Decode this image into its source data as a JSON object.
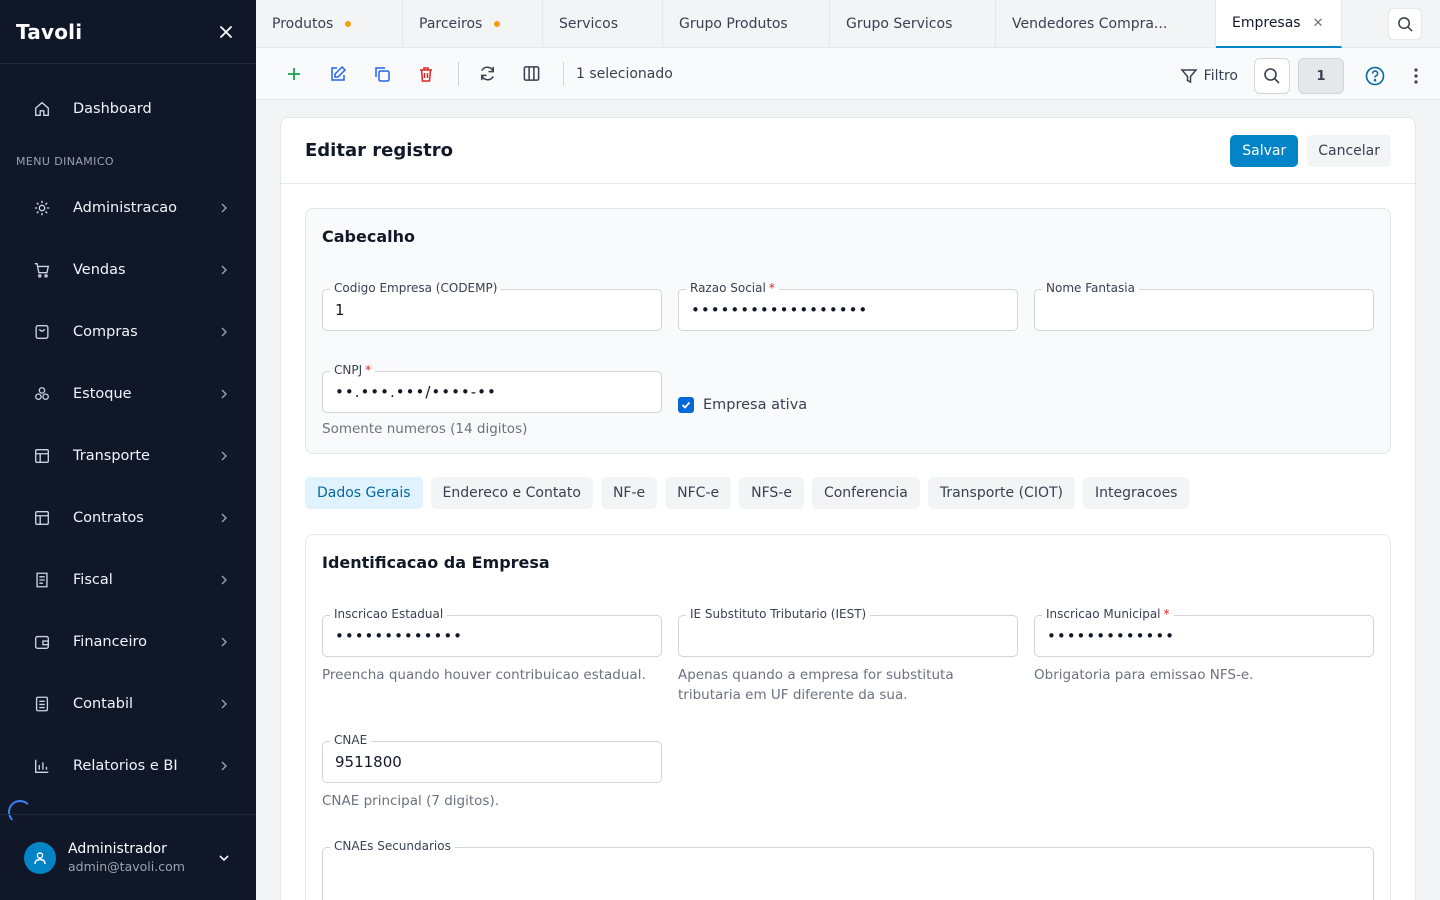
{
  "sidebar": {
    "brand": "Tavoli",
    "dashboard": "Dashboard",
    "section_label": "MENU DINAMICO",
    "items": [
      {
        "label": "Administracao",
        "icon": "gear-icon"
      },
      {
        "label": "Vendas",
        "icon": "cart-icon"
      },
      {
        "label": "Compras",
        "icon": "bag-icon"
      },
      {
        "label": "Estoque",
        "icon": "boxes-icon"
      },
      {
        "label": "Transporte",
        "icon": "layout-icon"
      },
      {
        "label": "Contratos",
        "icon": "layout-icon"
      },
      {
        "label": "Fiscal",
        "icon": "receipt-icon"
      },
      {
        "label": "Financeiro",
        "icon": "wallet-icon"
      },
      {
        "label": "Contabil",
        "icon": "book-icon"
      },
      {
        "label": "Relatorios e BI",
        "icon": "bar-chart-icon"
      }
    ],
    "user": {
      "name": "Administrador",
      "email": "admin@tavoli.com"
    }
  },
  "tabs": [
    {
      "label": "Produtos",
      "dirty": true
    },
    {
      "label": "Parceiros",
      "dirty": true
    },
    {
      "label": "Servicos",
      "dirty": false
    },
    {
      "label": "Grupo Produtos",
      "dirty": false
    },
    {
      "label": "Grupo Servicos",
      "dirty": false
    },
    {
      "label": "Vendedores Compra...",
      "dirty": false
    },
    {
      "label": "Empresas",
      "active": true
    }
  ],
  "toolbar": {
    "selected_text": "1 selecionado",
    "filter_label": "Filtro",
    "count": "1"
  },
  "form": {
    "title": "Editar registro",
    "save_label": "Salvar",
    "cancel_label": "Cancelar",
    "header_section": {
      "title": "Cabecalho",
      "codemp_label": "Codigo Empresa (CODEMP)",
      "codemp_value": "1",
      "razao_label": "Razao Social",
      "razao_value": "••••••••••••••••••",
      "fantasia_label": "Nome Fantasia",
      "fantasia_value": "",
      "cnpj_label": "CNPJ",
      "cnpj_value": "••.•••.•••/••••-••",
      "cnpj_hint": "Somente numeros (14 digitos)",
      "ativa_label": "Empresa ativa"
    },
    "subtabs": [
      "Dados Gerais",
      "Endereco e Contato",
      "NF-e",
      "NFC-e",
      "NFS-e",
      "Conferencia",
      "Transporte (CIOT)",
      "Integracoes"
    ],
    "ident_section": {
      "title": "Identificacao da Empresa",
      "ie_label": "Inscricao Estadual",
      "ie_value": "•••••••••••••",
      "ie_hint": "Preencha quando houver contribuicao estadual.",
      "iest_label": "IE Substituto Tributario (IEST)",
      "iest_value": "",
      "iest_hint": "Apenas quando a empresa for substituta tributaria em UF diferente da sua.",
      "im_label": "Inscricao Municipal",
      "im_value": "•••••••••••••",
      "im_hint": "Obrigatoria para emissao NFS-e.",
      "cnae_label": "CNAE",
      "cnae_value": "9511800",
      "cnae_hint": "CNAE principal (7 digitos).",
      "cnaes_sec_label": "CNAEs Secundarios",
      "cnaes_sec_value": ""
    }
  },
  "colors": {
    "sidebar_bg": "#0f1729",
    "primary": "#0284c7",
    "required": "#dc2626",
    "dirty_dot": "#f59e0b"
  }
}
